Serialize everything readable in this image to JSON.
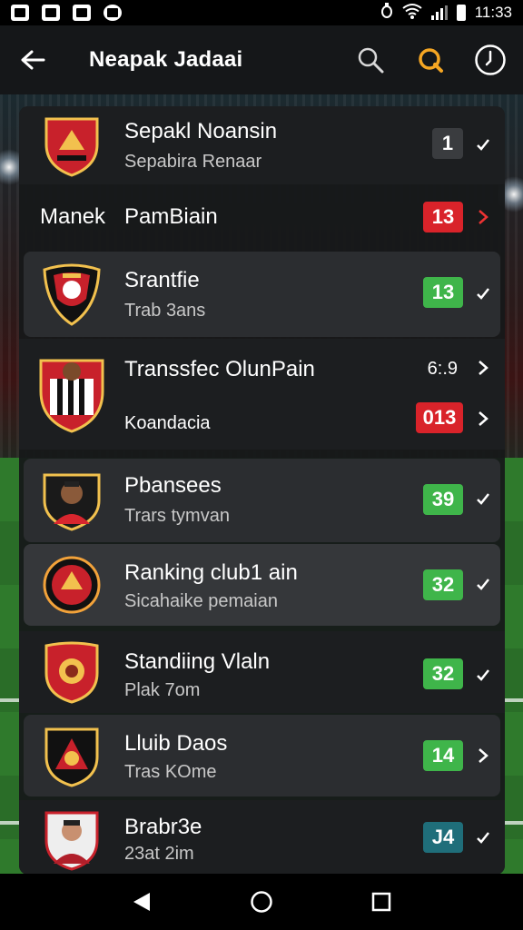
{
  "status": {
    "time": "11:33"
  },
  "header": {
    "title": "Neapak Jadaai",
    "accent": "#f5a623"
  },
  "section": {
    "left_label": "Manek",
    "title": "PamBiain",
    "badge": "13"
  },
  "rows": [
    {
      "title": "Sepakl Noansin",
      "sub": "Sepabira Renaar",
      "badge": "1",
      "badge_color": "gray",
      "trail": "check"
    },
    {
      "title": "Srantfie",
      "sub": "Trab 3ans",
      "badge": "13",
      "badge_color": "green",
      "trail": "check"
    },
    {
      "title": "Transsfec OlunPain",
      "value": "6:.9",
      "sub": "Koandacia",
      "badge": "013",
      "badge_color": "red",
      "trail": "chevron"
    },
    {
      "title": "Pbansees",
      "sub": "Trars tymvan",
      "badge": "39",
      "badge_color": "green",
      "trail": "check"
    },
    {
      "title": "Ranking club1 ain",
      "sub": "Sicahaike pemaian",
      "badge": "32",
      "badge_color": "green",
      "trail": "check"
    },
    {
      "title": "Standiing Vlaln",
      "sub": "Plak 7om",
      "badge": "32",
      "badge_color": "green",
      "trail": "check"
    },
    {
      "title": "Lluib Daos",
      "sub": "Tras KOme",
      "badge": "14",
      "badge_color": "green",
      "trail": "chevron"
    },
    {
      "title": "Brabr3e",
      "sub": "23at 2im",
      "badge": "J4",
      "badge_color": "teal",
      "trail": "check"
    }
  ],
  "icons": {
    "back": "arrow-left-icon",
    "search": "search-icon",
    "refresh": "refresh-icon",
    "clock": "clock-icon",
    "nav_back": "triangle-back-icon",
    "nav_home": "circle-home-icon",
    "nav_recents": "square-recents-icon"
  },
  "colors": {
    "green": "#3fb54a",
    "red": "#d9232a",
    "panel": "#16181a"
  }
}
